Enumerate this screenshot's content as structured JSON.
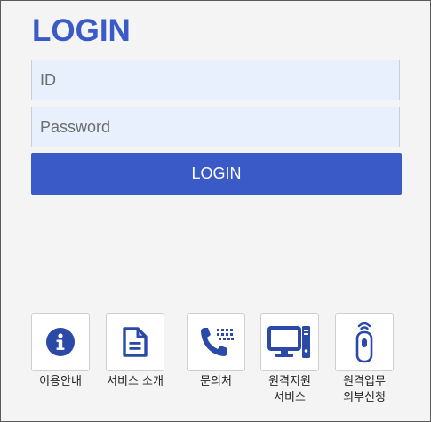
{
  "login": {
    "title": "LOGIN",
    "id_placeholder": "ID",
    "password_placeholder": "Password",
    "button_label": "LOGIN"
  },
  "services": [
    {
      "icon": "info-icon",
      "label": "이용안내"
    },
    {
      "icon": "document-icon",
      "label": "서비스 소개"
    },
    {
      "icon": "phone-keypad-icon",
      "label": "문의처"
    },
    {
      "icon": "computer-icon",
      "label": "원격지원\n서비스"
    },
    {
      "icon": "remote-control-icon",
      "label": "원격업무\n외부신청"
    }
  ],
  "colors": {
    "accent": "#3a5bc7",
    "icon": "#2b4aa8",
    "field_bg": "#e8f0fe",
    "panel_bg": "#f4f4f4"
  }
}
